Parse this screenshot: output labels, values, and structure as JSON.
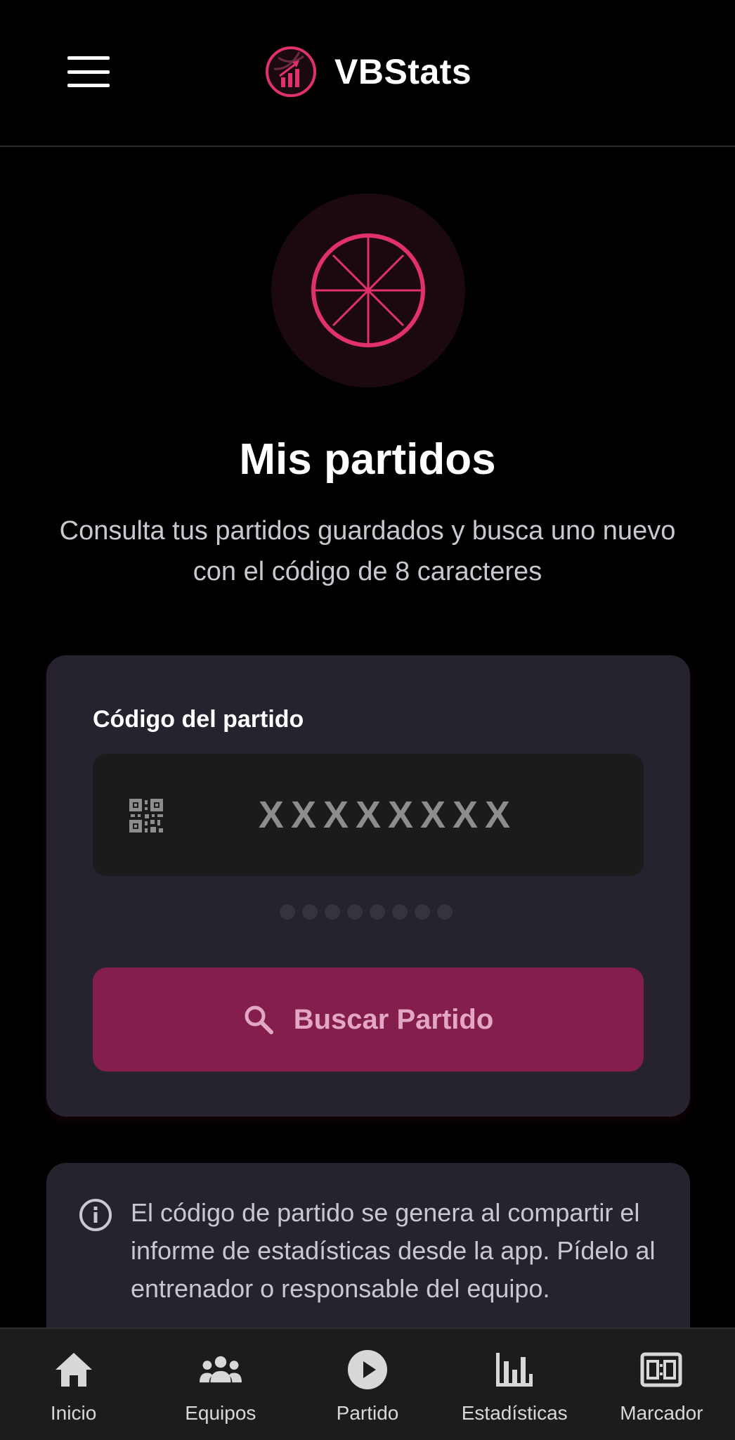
{
  "header": {
    "app_name": "VBStats",
    "menu_icon": "hamburger-menu-icon",
    "logo_icon": "volleyball-chart-logo"
  },
  "hero": {
    "icon": "volleyball-icon",
    "title": "Mis partidos",
    "subtitle": "Consulta tus partidos guardados y busca uno nuevo con el código de 8 caracteres"
  },
  "search_card": {
    "field_label": "Código del partido",
    "input_placeholder": "XXXXXXXX",
    "input_value": "",
    "input_icon": "qr-code-icon",
    "code_length": 8,
    "entered_characters": 0,
    "button_label": "Buscar Partido",
    "button_icon": "search-icon"
  },
  "info_card": {
    "icon": "info-icon",
    "text": "El código de partido se genera al compartir el informe de estadísticas desde la app. Pídelo al entrenador o responsable del equipo."
  },
  "bottom_nav": {
    "items": [
      {
        "label": "Inicio",
        "icon": "home-icon"
      },
      {
        "label": "Equipos",
        "icon": "group-icon"
      },
      {
        "label": "Partido",
        "icon": "play-circle-icon"
      },
      {
        "label": "Estadísticas",
        "icon": "bar-chart-icon"
      },
      {
        "label": "Marcador",
        "icon": "scoreboard-icon"
      }
    ]
  },
  "colors": {
    "background": "#000000",
    "card": "#26232f",
    "input_background": "#1b1b1c",
    "accent": "#e0306e",
    "button": "#841e4c",
    "button_text": "#e3a7c1",
    "bottom_nav": "#1c1c1c"
  }
}
